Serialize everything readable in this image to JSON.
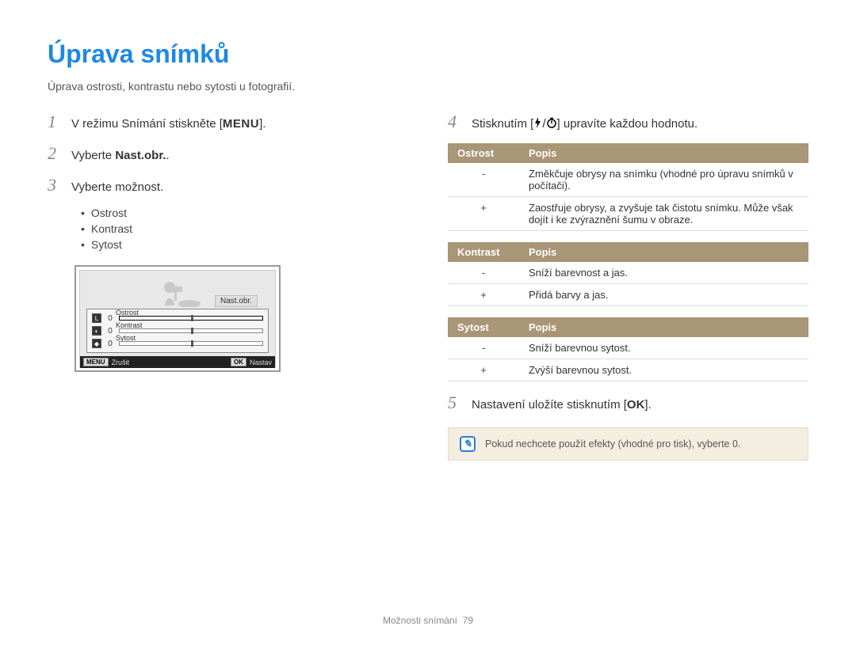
{
  "title": "Úprava snímků",
  "subtitle": "Úprava ostrosti, kontrastu nebo sytosti u fotografií.",
  "left": {
    "step1_pre": "V režimu Snímání stiskněte [",
    "step1_menu": "MENU",
    "step1_post": "].",
    "step2_pre": "Vyberte ",
    "step2_bold": "Nast.obr.",
    "step2_post": ".",
    "step3": "Vyberte možnost.",
    "bullets": [
      "Ostrost",
      "Kontrast",
      "Sytost"
    ]
  },
  "lcd": {
    "tag": "Nast.obr.",
    "rows": [
      {
        "icon": "L",
        "val": "0",
        "label": "Ostrost"
      },
      {
        "icon": "◐",
        "val": "0",
        "label": "Kontrast"
      },
      {
        "icon": "◆",
        "val": "0",
        "label": "Sytost"
      }
    ],
    "footer_left_badge": "MENU",
    "footer_left": "Zrušit",
    "footer_right_badge": "OK",
    "footer_right": "Nastav"
  },
  "right": {
    "step4_pre": "Stisknutím [",
    "step4_post": "] upravíte každou hodnotu.",
    "step5_pre": "Nastavení uložíte stisknutím [",
    "step5_post": "].",
    "ok_label": "OK"
  },
  "tables": [
    {
      "headers": [
        "Ostrost",
        "Popis"
      ],
      "rows": [
        {
          "key": "-",
          "desc": "Změkčuje obrysy na snímku (vhodné pro úpravu snímků v počítači)."
        },
        {
          "key": "+",
          "desc": "Zaostřuje obrysy, a zvyšuje tak čistotu snímku. Může však dojít i ke zvýraznění šumu v obraze."
        }
      ]
    },
    {
      "headers": [
        "Kontrast",
        "Popis"
      ],
      "rows": [
        {
          "key": "-",
          "desc": "Sníží barevnost a jas."
        },
        {
          "key": "+",
          "desc": "Přidá barvy a jas."
        }
      ]
    },
    {
      "headers": [
        "Sytost",
        "Popis"
      ],
      "rows": [
        {
          "key": "-",
          "desc": "Sníží barevnou sytost."
        },
        {
          "key": "+",
          "desc": "Zvýší barevnou sytost."
        }
      ]
    }
  ],
  "note": "Pokud nechcete použít efekty (vhodné pro tisk), vyberte 0.",
  "footer": {
    "section": "Možnosti snímání",
    "page": "79"
  }
}
